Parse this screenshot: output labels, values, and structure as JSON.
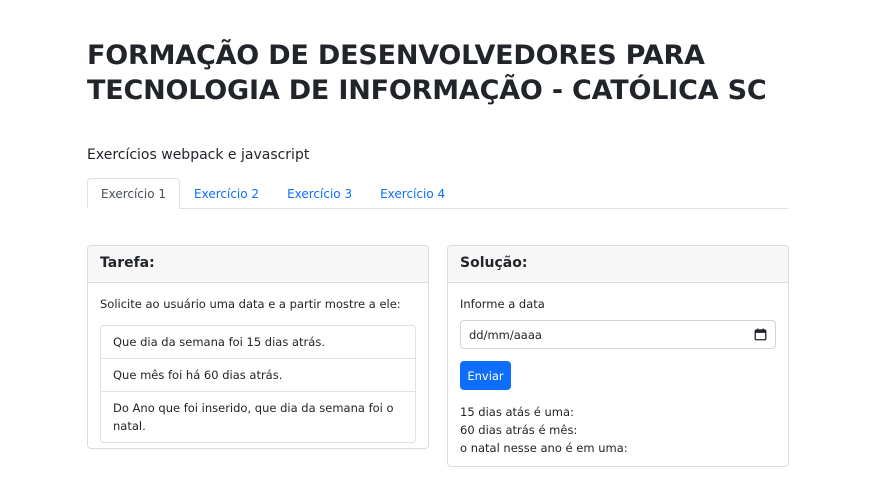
{
  "header": {
    "title_line1": "FORMAÇÃO DE DESENVOLVEDORES PARA",
    "title_line2": "TECNOLOGIA DE INFORMAÇÃO - CATÓLICA SC",
    "subtitle": "Exercícios webpack e javascript"
  },
  "tabs": [
    {
      "label": "Exercício 1",
      "active": true
    },
    {
      "label": "Exercício 2",
      "active": false
    },
    {
      "label": "Exercício 3",
      "active": false
    },
    {
      "label": "Exercício 4",
      "active": false
    }
  ],
  "task": {
    "header": "Tarefa:",
    "intro": "Solicite ao usuário uma data e a partir mostre a ele:",
    "items": [
      "Que dia da semana foi 15 dias atrás.",
      "Que mês foi há 60 dias atrás.",
      "Do Ano que foi inserido, que dia da semana foi o natal."
    ]
  },
  "solution": {
    "header": "Solução:",
    "label": "Informe a data",
    "date_placeholder": "dd/mm/aaaa",
    "submit_label": "Enviar",
    "results": [
      "15 dias atás é uma:",
      "60 dias atrás é mês:",
      "o natal nesse ano é em uma:"
    ]
  },
  "colors": {
    "primary": "#0d6efd",
    "card_header_bg": "#f7f7f7"
  },
  "icons": {
    "date_picker": "calendar-icon"
  }
}
